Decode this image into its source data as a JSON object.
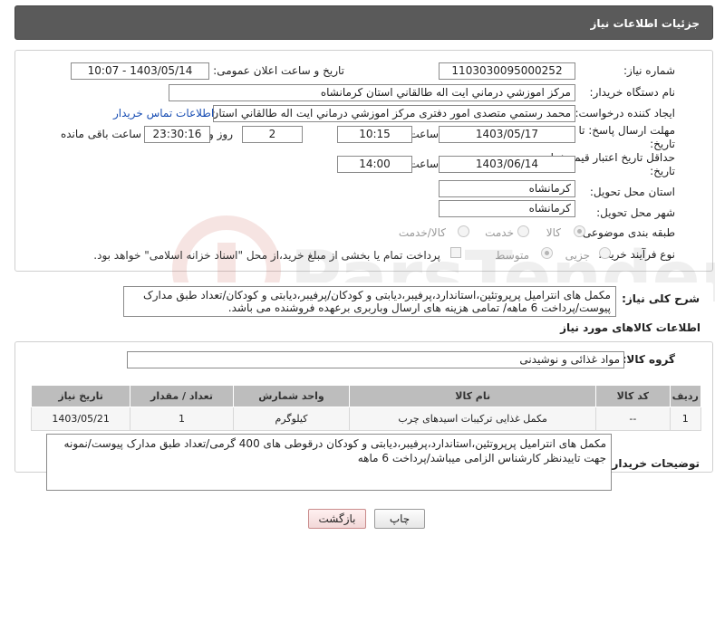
{
  "header": {
    "title": "جزئیات اطلاعات نیاز"
  },
  "form": {
    "need_number_label": "شماره نیاز:",
    "need_number": "1103030095000252",
    "announce_datetime_label": "تاریخ و ساعت اعلان عمومی:",
    "announce_datetime": "1403/05/14 - 10:07",
    "buyer_org_label": "نام دستگاه خریدار:",
    "buyer_org": "مرکز اموزشي درماني ايت اله طالقاني استان کرمانشاه",
    "requester_label": "ایجاد کننده درخواست:",
    "requester": "محمد رستمي متصدی امور دفتری مرکز اموزشي درماني ايت اله طالقاني استان",
    "contact_link": "اطلاعات تماس خریدار",
    "reply_deadline_label": "مهلت ارسال پاسخ: تا تاریخ:",
    "reply_date": "1403/05/17",
    "time_label": "ساعت",
    "reply_time": "10:15",
    "days_value": "2",
    "days_label": "روز و",
    "remaining_time": "23:30:16",
    "remaining_label": "ساعت باقی مانده",
    "price_validity_label": "حداقل تاریخ اعتبار قیمت: تا تاریخ:",
    "price_validity_date": "1403/06/14",
    "price_validity_time": "14:00",
    "province_label": "استان محل تحویل:",
    "province": "کرمانشاه",
    "city_label": "شهر محل تحویل:",
    "city": "کرمانشاه",
    "category_label": "طبقه بندی موضوعی:",
    "category_options": [
      "کالا",
      "خدمت",
      "کالا/خدمت"
    ],
    "purchase_type_label": "نوع فرآیند خرید :",
    "purchase_type_options": [
      "جزیی",
      "متوسط"
    ],
    "payment_note": "پرداخت تمام یا بخشی از مبلغ خرید،از محل \"اسناد خزانه اسلامی\" خواهد بود."
  },
  "description": {
    "label": "شرح کلی نیاز:",
    "text": "مکمل های انترامیل پرپروتئین،استاندارد،پرفیبر،دیابتی و کودکان/پرفیبر،دیابتی و کودکان/تعداد طبق مدارک پیوست/پرداخت 6 ماهه/ تمامی هزینه های ارسال وباربری برعهده فروشنده می باشد."
  },
  "goods": {
    "section_title": "اطلاعات کالاهای مورد نیاز",
    "group_label": "گروه کالا:",
    "group_value": "مواد غذائی و نوشیدنی",
    "columns": [
      "ردیف",
      "کد کالا",
      "نام کالا",
      "واحد شمارش",
      "تعداد / مقدار",
      "تاریخ نیاز"
    ],
    "rows": [
      [
        "1",
        "--",
        "مکمل غذایی ترکیبات اسیدهای چرب",
        "کیلوگرم",
        "1",
        "1403/05/21"
      ]
    ]
  },
  "buyer_notes": {
    "label": "توضیحات خریدار:",
    "text": "مکمل های انترامیل پرپروتئین،استاندارد،پرفیبر،دیابتی و کودکان درقوطی های 400 گرمی/تعداد طبق مدارک پیوست/نمونه جهت تاییدنظر کارشناس الزامی میباشد/پرداخت 6 ماهه"
  },
  "buttons": {
    "print": "چاپ",
    "back": "بازگشت"
  },
  "colors": {
    "header_bg": "#5a5a5a",
    "link": "#1a4fb4",
    "back_border": "#c98b8b"
  }
}
